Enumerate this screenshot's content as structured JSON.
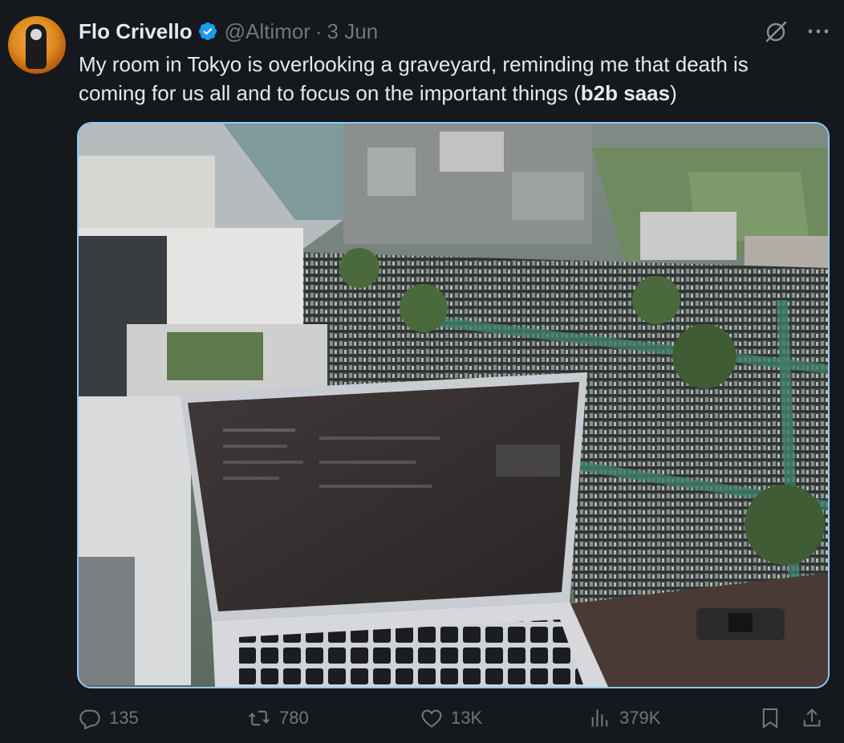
{
  "tweet": {
    "author_name": "Flo Crivello",
    "handle": "@Altimor",
    "separator": "·",
    "date": "3 Jun",
    "text_main": "My room in Tokyo is overlooking a graveyard, reminding me that death is coming for us all and to focus on the important things (",
    "text_bold": "b2b saas",
    "text_end": ")"
  },
  "icons": {
    "verified": "verified-badge-icon",
    "grok": "grok-icon",
    "more": "more-icon",
    "reply": "reply-icon",
    "retweet": "retweet-icon",
    "like": "like-icon",
    "views": "views-icon",
    "bookmark": "bookmark-icon",
    "share": "share-icon"
  },
  "actions": {
    "replies": "135",
    "retweets": "780",
    "likes": "13K",
    "views": "379K"
  },
  "colors": {
    "background": "#15181c",
    "text": "#e7e9ea",
    "muted": "#71767b",
    "verified": "#1d9bf0",
    "media_border": "#8ec8ff"
  }
}
